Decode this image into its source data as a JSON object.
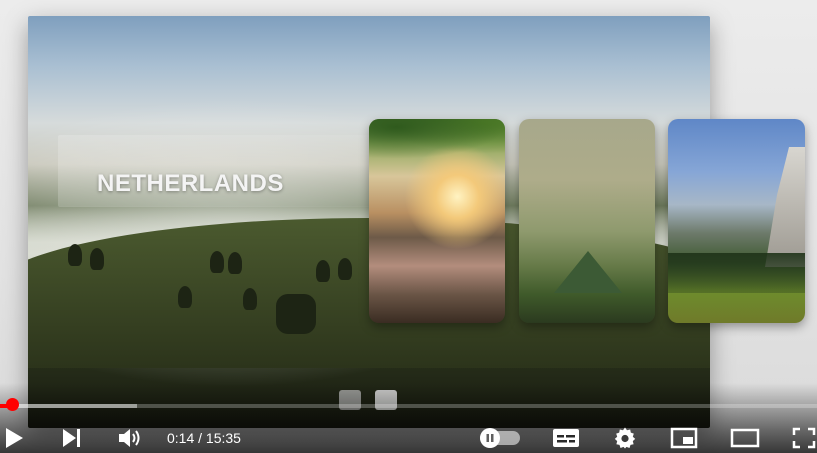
{
  "video": {
    "slide_title": "NETHERLANDS",
    "thumbnails": [
      {
        "subject": "sunset-lake-card"
      },
      {
        "subject": "valley-card"
      },
      {
        "subject": "mountain-cliff-card"
      }
    ],
    "pager_count": 2
  },
  "player": {
    "current_time": "0:14",
    "separator": " / ",
    "duration": "15:35",
    "played_fraction": 0.015,
    "buffered_fraction": 0.168,
    "autoplay_on": false,
    "colors": {
      "progress": "#ff0000",
      "controls": "#ffffff"
    },
    "icons": {
      "play": "play-icon",
      "next": "next-icon",
      "volume": "volume-icon",
      "autoplay": "autoplay-toggle",
      "captions": "captions-icon",
      "settings": "gear-icon",
      "miniplayer": "miniplayer-icon",
      "theater": "theater-mode-icon",
      "fullscreen": "fullscreen-icon"
    }
  }
}
